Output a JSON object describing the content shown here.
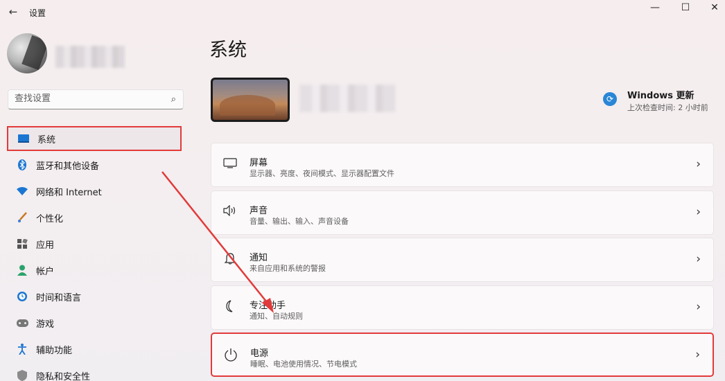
{
  "window": {
    "title": "设置",
    "back": "←",
    "minimize": "—",
    "maximize": "☐",
    "close": "✕"
  },
  "sidebar": {
    "search": {
      "placeholder": "查找设置",
      "icon": "⌕"
    },
    "items": [
      {
        "label": "系统",
        "icon": "system-icon",
        "active": true
      },
      {
        "label": "蓝牙和其他设备",
        "icon": "bluetooth-icon"
      },
      {
        "label": "网络和 Internet",
        "icon": "wifi-icon"
      },
      {
        "label": "个性化",
        "icon": "brush-icon"
      },
      {
        "label": "应用",
        "icon": "apps-icon"
      },
      {
        "label": "帐户",
        "icon": "account-icon"
      },
      {
        "label": "时间和语言",
        "icon": "clock-icon"
      },
      {
        "label": "游戏",
        "icon": "gamepad-icon"
      },
      {
        "label": "辅助功能",
        "icon": "accessibility-icon"
      },
      {
        "label": "隐私和安全性",
        "icon": "shield-icon"
      }
    ]
  },
  "main": {
    "title": "系统",
    "update": {
      "title": "Windows 更新",
      "subtitle": "上次检查时间: 2 小时前",
      "icon": "⟳"
    },
    "cards": [
      {
        "title": "屏幕",
        "desc": "显示器、亮度、夜间模式、显示器配置文件",
        "icon": "monitor-icon"
      },
      {
        "title": "声音",
        "desc": "音量、输出、输入、声音设备",
        "icon": "speaker-icon"
      },
      {
        "title": "通知",
        "desc": "来自应用和系统的警报",
        "icon": "bell-icon"
      },
      {
        "title": "专注助手",
        "desc": "通知、自动规则",
        "icon": "moon-icon"
      },
      {
        "title": "电源",
        "desc": "睡眠、电池使用情况、节电模式",
        "icon": "power-icon",
        "highlighted": true
      }
    ],
    "chevron": "›"
  },
  "colors": {
    "accent": "#0067c0",
    "annotation_red": "#e23a3a"
  }
}
